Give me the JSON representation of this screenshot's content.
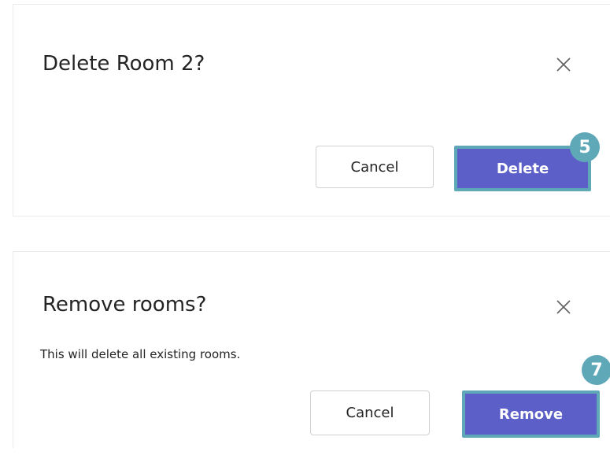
{
  "dialogs": [
    {
      "title": "Delete Room 2?",
      "message": "",
      "cancel_label": "Cancel",
      "confirm_label": "Delete",
      "step_badge": "5"
    },
    {
      "title": "Remove rooms?",
      "message": "This will delete all existing rooms.",
      "cancel_label": "Cancel",
      "confirm_label": "Remove",
      "step_badge": "7"
    }
  ],
  "icons": {
    "close": "close-icon"
  },
  "colors": {
    "primary_button": "#5b5fc7",
    "highlight": "#5fa8b8",
    "text": "#242424",
    "border": "#d1d1d1"
  }
}
